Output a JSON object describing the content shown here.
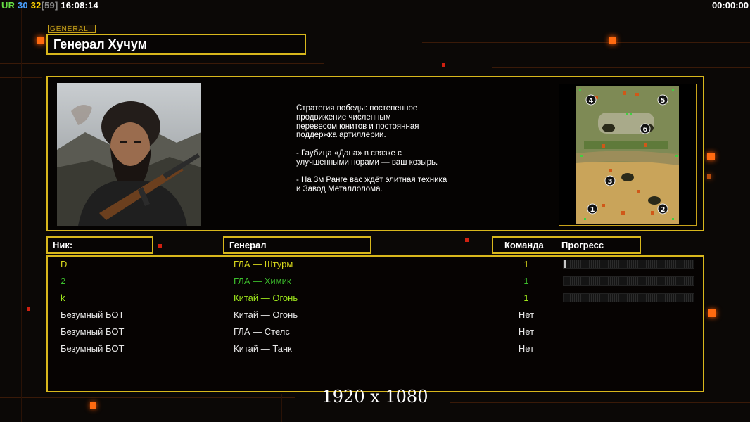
{
  "hud": {
    "left": [
      {
        "text": "UR",
        "color": "#66dd44"
      },
      {
        "text": "30",
        "color": "#4aa0ff"
      },
      {
        "text": "32",
        "color": "#ffd200"
      },
      {
        "text": "[59]",
        "color": "#888888"
      },
      {
        "text": "16:08:14",
        "color": "#ffffff"
      }
    ],
    "timer": "00:00:00"
  },
  "general": {
    "tag": "GENERAL",
    "name": "Генерал Хучум",
    "portrait_alt": "general-portrait",
    "description": "Стратегия победы: постепенное\nпродвижение численным\nперевесом юнитов и постоянная\nподдержка артиллерии.\n\n- Гаубица «Дана» в связке с\nулучшенными норами — ваш козырь.\n\n- На 3м Ранге вас ждёт элитная техника\nи Завод Металлолома."
  },
  "minimap": {
    "start_positions": [
      "4",
      "5",
      "6",
      "3",
      "1",
      "2"
    ]
  },
  "table": {
    "headers": {
      "nick": "Ник:",
      "general": "Генерал",
      "team": "Команда",
      "progress": "Прогресс"
    },
    "rows": [
      {
        "nick": "D",
        "general": "ГЛА — Штурм",
        "team": "1",
        "color": "#d8d81c",
        "progress": 0.01
      },
      {
        "nick": "2",
        "general": "ГЛА — Химик",
        "team": "1",
        "color": "#3cbf2c",
        "progress": 0.0
      },
      {
        "nick": "k",
        "general": "Китай — Огонь",
        "team": "1",
        "color": "#9fe81c",
        "progress": 0.0
      },
      {
        "nick": "Безумный БОТ",
        "general": "Китай — Огонь",
        "team": "Нет",
        "color": "#ffffff"
      },
      {
        "nick": "Безумный БОТ",
        "general": "ГЛА — Стелс",
        "team": "Нет",
        "color": "#ffffff"
      },
      {
        "nick": "Безумный БОТ",
        "general": "Китай — Танк",
        "team": "Нет",
        "color": "#ffffff"
      }
    ]
  },
  "resolution_label": "1920 x 1080",
  "colors": {
    "accent_frame": "#d8b71c",
    "background": "#0b0806",
    "glow": "#ff6a10"
  }
}
